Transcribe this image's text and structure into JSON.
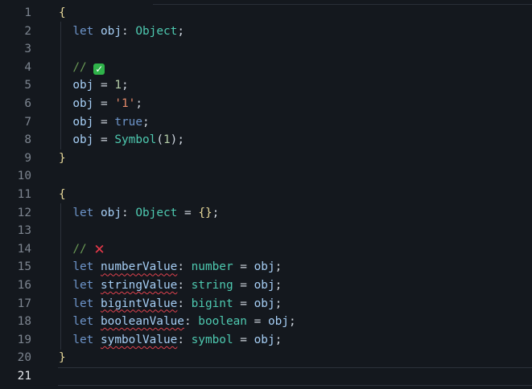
{
  "editor": {
    "lines": [
      {
        "n": "1",
        "tokens": [
          [
            "brace",
            "{"
          ]
        ]
      },
      {
        "n": "2",
        "tokens": [
          [
            "kw",
            "  let"
          ],
          [
            "punc",
            " "
          ],
          [
            "var",
            "obj"
          ],
          [
            "punc",
            ": "
          ],
          [
            "type",
            "Object"
          ],
          [
            "punc",
            ";"
          ]
        ]
      },
      {
        "n": "3",
        "tokens": []
      },
      {
        "n": "4",
        "tokens": [
          [
            "cm",
            "  // "
          ],
          [
            "icon-check",
            "✓"
          ]
        ]
      },
      {
        "n": "5",
        "tokens": [
          [
            "var",
            "  obj"
          ],
          [
            "punc",
            " = "
          ],
          [
            "num",
            "1"
          ],
          [
            "punc",
            ";"
          ]
        ]
      },
      {
        "n": "6",
        "tokens": [
          [
            "var",
            "  obj"
          ],
          [
            "punc",
            " = "
          ],
          [
            "str",
            "'1'"
          ],
          [
            "punc",
            ";"
          ]
        ]
      },
      {
        "n": "7",
        "tokens": [
          [
            "var",
            "  obj"
          ],
          [
            "punc",
            " = "
          ],
          [
            "bool",
            "true"
          ],
          [
            "punc",
            ";"
          ]
        ]
      },
      {
        "n": "8",
        "tokens": [
          [
            "var",
            "  obj"
          ],
          [
            "punc",
            " = "
          ],
          [
            "fn",
            "Symbol"
          ],
          [
            "punc",
            "("
          ],
          [
            "num",
            "1"
          ],
          [
            "punc",
            ");"
          ]
        ]
      },
      {
        "n": "9",
        "tokens": [
          [
            "brace",
            "}"
          ]
        ]
      },
      {
        "n": "10",
        "tokens": []
      },
      {
        "n": "11",
        "tokens": [
          [
            "brace",
            "{"
          ]
        ]
      },
      {
        "n": "12",
        "tokens": [
          [
            "kw",
            "  let"
          ],
          [
            "punc",
            " "
          ],
          [
            "var",
            "obj"
          ],
          [
            "punc",
            ": "
          ],
          [
            "type",
            "Object"
          ],
          [
            "punc",
            " = "
          ],
          [
            "brace",
            "{}"
          ],
          [
            "punc",
            ";"
          ]
        ]
      },
      {
        "n": "13",
        "tokens": []
      },
      {
        "n": "14",
        "tokens": [
          [
            "cm",
            "  // "
          ],
          [
            "icon-cross",
            "✕"
          ]
        ]
      },
      {
        "n": "15",
        "tokens": [
          [
            "kw",
            "  let"
          ],
          [
            "punc",
            " "
          ],
          [
            "err",
            "numberValue"
          ],
          [
            "punc",
            ": "
          ],
          [
            "type",
            "number"
          ],
          [
            "punc",
            " = "
          ],
          [
            "var",
            "obj"
          ],
          [
            "punc",
            ";"
          ]
        ]
      },
      {
        "n": "16",
        "tokens": [
          [
            "kw",
            "  let"
          ],
          [
            "punc",
            " "
          ],
          [
            "err",
            "stringValue"
          ],
          [
            "punc",
            ": "
          ],
          [
            "type",
            "string"
          ],
          [
            "punc",
            " = "
          ],
          [
            "var",
            "obj"
          ],
          [
            "punc",
            ";"
          ]
        ]
      },
      {
        "n": "17",
        "tokens": [
          [
            "kw",
            "  let"
          ],
          [
            "punc",
            " "
          ],
          [
            "err",
            "bigintValue"
          ],
          [
            "punc",
            ": "
          ],
          [
            "type",
            "bigint"
          ],
          [
            "punc",
            " = "
          ],
          [
            "var",
            "obj"
          ],
          [
            "punc",
            ";"
          ]
        ]
      },
      {
        "n": "18",
        "tokens": [
          [
            "kw",
            "  let"
          ],
          [
            "punc",
            " "
          ],
          [
            "err",
            "booleanValue"
          ],
          [
            "punc",
            ": "
          ],
          [
            "type",
            "boolean"
          ],
          [
            "punc",
            " = "
          ],
          [
            "var",
            "obj"
          ],
          [
            "punc",
            ";"
          ]
        ]
      },
      {
        "n": "19",
        "tokens": [
          [
            "kw",
            "  let"
          ],
          [
            "punc",
            " "
          ],
          [
            "err",
            "symbolValue"
          ],
          [
            "punc",
            ": "
          ],
          [
            "type",
            "symbol"
          ],
          [
            "punc",
            " = "
          ],
          [
            "var",
            "obj"
          ],
          [
            "punc",
            ";"
          ]
        ]
      },
      {
        "n": "20",
        "tokens": [
          [
            "brace",
            "}"
          ]
        ]
      },
      {
        "n": "21",
        "tokens": [],
        "active": true
      }
    ],
    "colors": {
      "background": "#14181e",
      "keyword": "#6d94c9",
      "type": "#4ec9b0",
      "error_squiggle": "#e0424e",
      "check_badge": "#2fb34a"
    },
    "icons": {
      "check": "check-mark-button-icon",
      "cross": "cross-mark-icon"
    }
  }
}
